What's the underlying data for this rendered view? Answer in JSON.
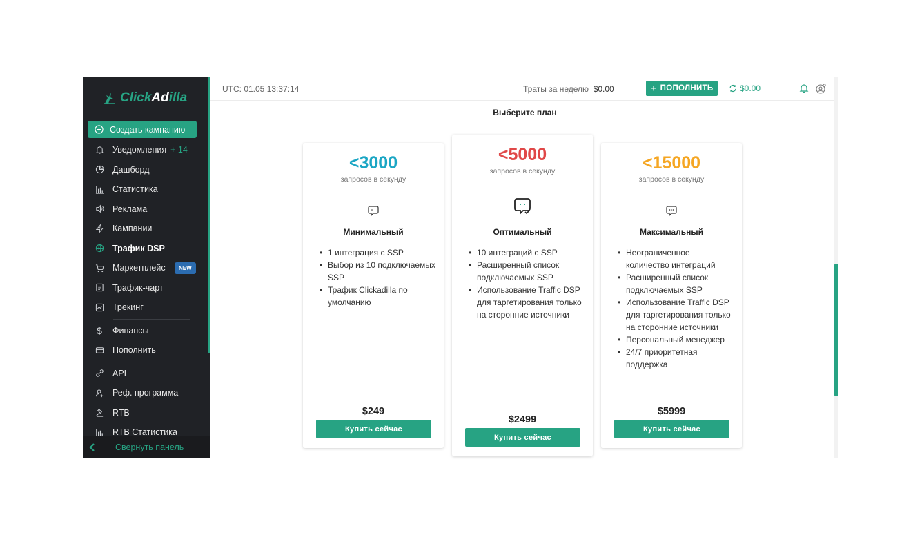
{
  "app": {
    "logo_prefix": "Click",
    "logo_bold": "Ad",
    "logo_suffix": "illa"
  },
  "sidebar": {
    "create_label": "Создать кампанию",
    "items": [
      {
        "label": "Уведомления",
        "count": "+ 14",
        "icon": "bell-icon"
      },
      {
        "label": "Дашборд",
        "icon": "pie-chart-icon"
      },
      {
        "label": "Статистика",
        "icon": "bar-chart-icon"
      },
      {
        "label": "Реклама",
        "icon": "speaker-icon"
      },
      {
        "label": "Кампании",
        "icon": "lightning-icon"
      },
      {
        "label": "Трафик DSP",
        "icon": "globe-icon",
        "active": true
      },
      {
        "label": "Маркетплейс",
        "badge": "NEW",
        "icon": "cart-icon"
      },
      {
        "label": "Трафик-чарт",
        "icon": "document-icon"
      },
      {
        "label": "Трекинг",
        "icon": "tracking-icon"
      },
      {
        "label": "Финансы",
        "icon": "dollar-icon"
      },
      {
        "label": "Пополнить",
        "icon": "card-icon"
      },
      {
        "label": "API",
        "icon": "api-icon"
      },
      {
        "label": "Реф. программа",
        "icon": "user-plus-icon"
      },
      {
        "label": "RTB",
        "icon": "gavel-icon"
      },
      {
        "label": "RTB Статистика",
        "icon": "bar-chart-icon"
      }
    ],
    "collapse_label": "Свернуть панель"
  },
  "topbar": {
    "utc": "UTC: 01.05 13:37:14",
    "spend_label": "Траты за неделю",
    "spend_value": "$0.00",
    "topup_label": "ПОПОЛНИТЬ",
    "balance": "$0.00"
  },
  "main": {
    "title": "Выберите план",
    "plans": [
      {
        "limit": "<3000",
        "unit": "запросов в секунду",
        "name": "Минимальный",
        "color": "#1ba6c4",
        "features": [
          "1 интеграция с SSP",
          "Выбор из 10 подключаемых SSP",
          "Трафик Clickadilla по умолчанию"
        ],
        "price": "$249",
        "buy": "Купить сейчас"
      },
      {
        "limit": "<5000",
        "unit": "запросов в секунду",
        "name": "Оптимальный",
        "color": "#e04848",
        "features": [
          "10 интеграций с SSP",
          "Расширенный список подключаемых SSP",
          "Использование Traffic DSP для таргетирования только на сторонние источники"
        ],
        "price": "$2499",
        "buy": "Купить сейчас"
      },
      {
        "limit": "<15000",
        "unit": "запросов в секунду",
        "name": "Максимальный",
        "color": "#f5a623",
        "features": [
          "Неограниченное количество интеграций",
          "Расширенный список подключаемых SSP",
          "Использование Traffic DSP для таргетирования только на сторонние источники",
          "Персональный менеджер",
          "24/7 приоритетная поддержка"
        ],
        "price": "$5999",
        "buy": "Купить сейчас"
      }
    ]
  }
}
